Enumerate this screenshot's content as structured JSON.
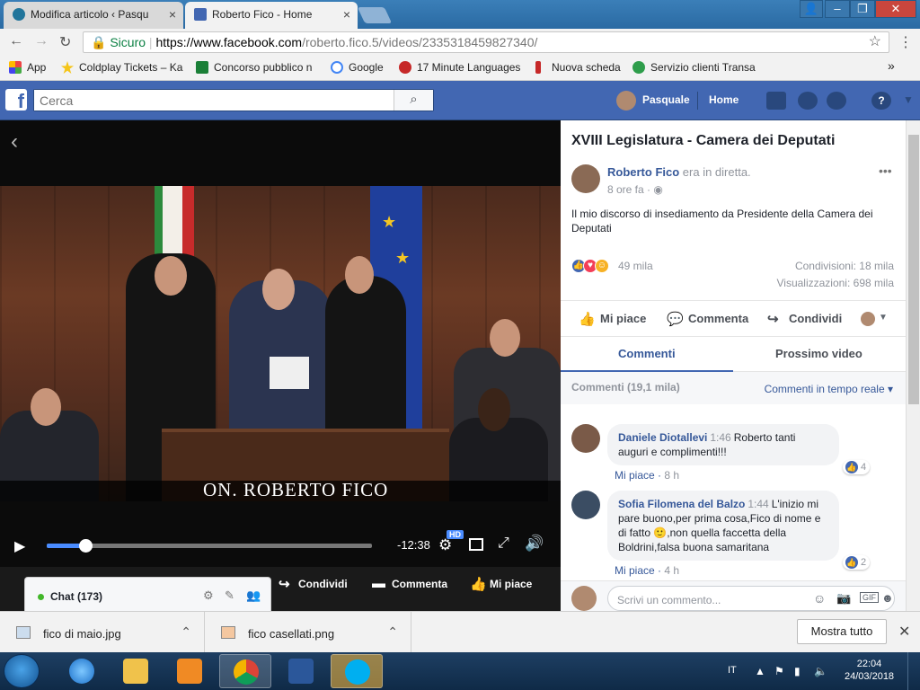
{
  "browser": {
    "tabs": [
      {
        "label": "Modifica articolo ‹ Pasqu",
        "icon": "wordpress-icon"
      },
      {
        "label": "Roberto Fico - Home",
        "icon": "facebook-icon"
      }
    ],
    "secure_label": "Sicuro",
    "url_host": "https://www.facebook.com",
    "url_path": "/roberto.fico.5/videos/2335318459827340/",
    "bookmarks": [
      {
        "label": "App",
        "color": "#e44"
      },
      {
        "label": "Coldplay Tickets – Ka",
        "color": "#f5c518"
      },
      {
        "label": "Concorso pubblico n",
        "color": "#1a7f37"
      },
      {
        "label": "Google",
        "color": "#4285f4"
      },
      {
        "label": "17 Minute Languages",
        "color": "#c62828"
      },
      {
        "label": "Nuova scheda",
        "color": "#c62828"
      },
      {
        "label": "Servizio clienti Transa",
        "color": "#2e9d4b"
      }
    ],
    "bookmarks_more": "»"
  },
  "facebook": {
    "search_placeholder": "Cerca",
    "user_name": "Pasquale",
    "home_label": "Home",
    "brand_color": "#4267b2"
  },
  "video": {
    "caption": "ON. ROBERTO FICO",
    "time_remaining": "-12:38",
    "progress": 0.12,
    "hd_badge": "HD",
    "chat_label": "Chat (173)",
    "actions": {
      "share": "Condividi",
      "comment": "Commenta",
      "like": "Mi piace"
    }
  },
  "post": {
    "title": "XVIII Legislatura - Camera dei Deputati",
    "author": "Roberto Fico",
    "author_suffix": "era in diretta.",
    "time": "8 ore fa",
    "description": "Il mio discorso di insediamento da Presidente della Camera dei Deputati",
    "reactions_count": "49 mila",
    "shares": "Condivisioni: 18 mila",
    "views": "Visualizzazioni: 698 mila",
    "actions": {
      "like": "Mi piace",
      "comment": "Commenta",
      "share": "Condividi"
    },
    "tabs": {
      "comments": "Commenti",
      "next": "Prossimo video"
    },
    "comments_count": "Commenti (19,1 mila)",
    "comments_filter": "Commenti in tempo reale ▾",
    "comments": [
      {
        "author": "Daniele Diotallevi",
        "time": "1:46",
        "text": "Roberto tanti auguri e complimenti!!!",
        "like_label": "Mi piace",
        "age": "8 h",
        "likes": "4"
      },
      {
        "author": "Sofia Filomena del Balzo",
        "time": "1:44",
        "text": "L'inizio mi pare buono,per prima cosa,Fico di nome e di fatto 🙂,non quella faccetta della Boldrini,falsa buona samaritana",
        "like_label": "Mi piace",
        "age": "4 h",
        "likes": "2"
      }
    ],
    "compose_placeholder": "Scrivi un commento..."
  },
  "downloads": {
    "items": [
      {
        "name": "fico di maio.jpg"
      },
      {
        "name": "fico casellati.png"
      }
    ],
    "show_all": "Mostra tutto"
  },
  "taskbar": {
    "lang": "IT",
    "time": "22:04",
    "date": "24/03/2018"
  }
}
